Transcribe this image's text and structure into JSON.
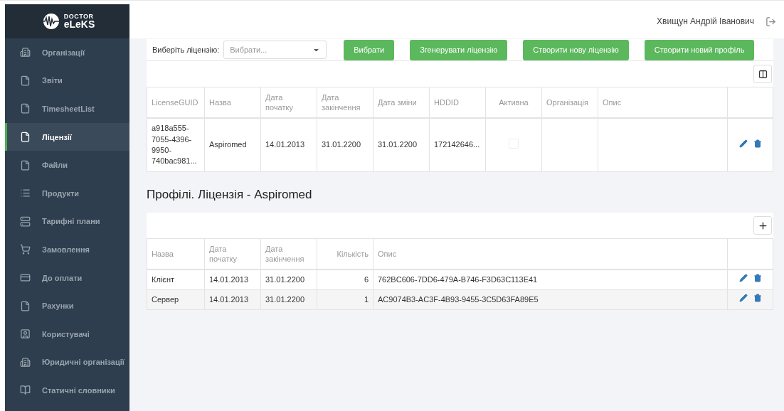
{
  "sidebar": {
    "logo": {
      "line1": "DOCTOR",
      "line2": "eLeKS"
    },
    "items": [
      {
        "label": "Організації",
        "selected": false
      },
      {
        "label": "Звіти",
        "selected": false
      },
      {
        "label": "TimesheetList",
        "selected": false
      },
      {
        "label": "Ліцензії",
        "selected": true
      },
      {
        "label": "Файли",
        "selected": false
      },
      {
        "label": "Продукти",
        "selected": false
      },
      {
        "label": "Тарифні плани",
        "selected": false
      },
      {
        "label": "Замовлення",
        "selected": false
      },
      {
        "label": "До оплати",
        "selected": false
      },
      {
        "label": "Рахунки",
        "selected": false
      },
      {
        "label": "Користувачі",
        "selected": false
      },
      {
        "label": "Юридичні організації",
        "selected": false
      },
      {
        "label": "Статичні словники",
        "selected": false
      }
    ]
  },
  "header": {
    "user": "Хвищун Андрій Іванович"
  },
  "license_toolbar": {
    "label": "Виберіть ліцензію:",
    "select": {
      "placeholder": "Вибрати..."
    },
    "buttons": [
      "Вибрати",
      "Згенерувати ліцензію",
      "Створити нову ліцензію",
      "Створити новий профіль"
    ]
  },
  "license_table": {
    "columns": [
      "LicenseGUID",
      "Назва",
      "Дата початку",
      "Дата закінчення",
      "Дата зміни",
      "HDDID",
      "Активна",
      "Організація",
      "Опис"
    ],
    "rows": [
      {
        "guid": "a918a555-7055-4396-9950-740bac981...",
        "name": "Aspiromed",
        "start": "14.01.2013",
        "end": "31.01.2200",
        "changed": "31.01.2200",
        "hddid": "172142646...",
        "active": false
      }
    ]
  },
  "profiles_title": "Профілі. Ліцензія - Aspiromed",
  "profiles_table": {
    "columns": [
      "Назва",
      "Дата початку",
      "Дата закінчення",
      "Кількість",
      "Опис"
    ],
    "rows": [
      {
        "name": "Клієнт",
        "start": "14.01.2013",
        "end": "31.01.2200",
        "count": "6",
        "description": "762BC606-7DD6-479A-B746-F3D63C113E41"
      },
      {
        "name": "Сервер",
        "start": "14.01.2013",
        "end": "31.01.2200",
        "count": "1",
        "description": "AC9074B3-AC3F-4B93-9455-3C5D63FA89E5"
      }
    ]
  }
}
